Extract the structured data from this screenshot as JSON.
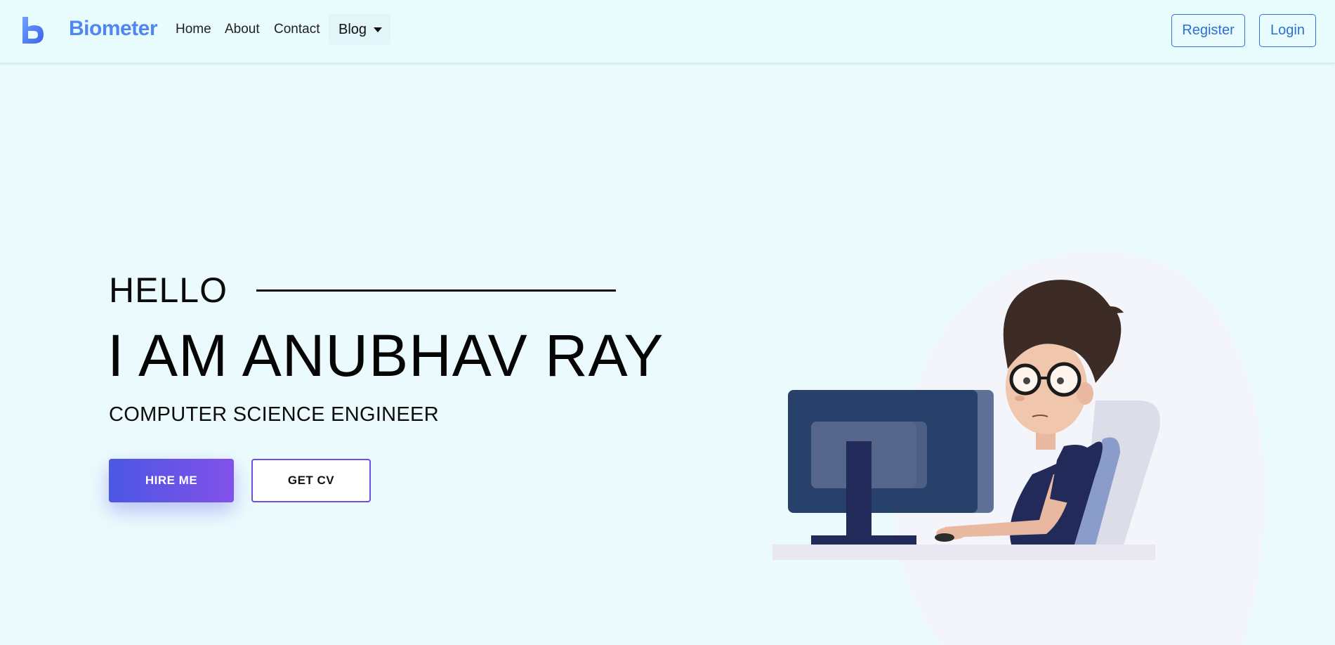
{
  "navbar": {
    "logo_icon": "letter-b-logo-icon",
    "brand": "Biometer",
    "links": [
      "Home",
      "About",
      "Contact"
    ],
    "dropdown_label": "Blog",
    "dropdown_icon": "caret-down-icon",
    "register_label": "Register",
    "login_label": "Login"
  },
  "hero": {
    "greeting": "HELLO",
    "name": "I AM ANUBHAV RAY",
    "subtitle": "COMPUTER SCIENCE ENGINEER",
    "hire_label": "HIRE ME",
    "cv_label": "GET CV",
    "illustration": "developer-at-computer-illustration"
  },
  "colors": {
    "page_background": "#ebfbfd",
    "brand": "#4f86f0",
    "outline_button": "#2f72d6",
    "gradient_start": "#4b57e3",
    "gradient_end": "#8351ea"
  }
}
